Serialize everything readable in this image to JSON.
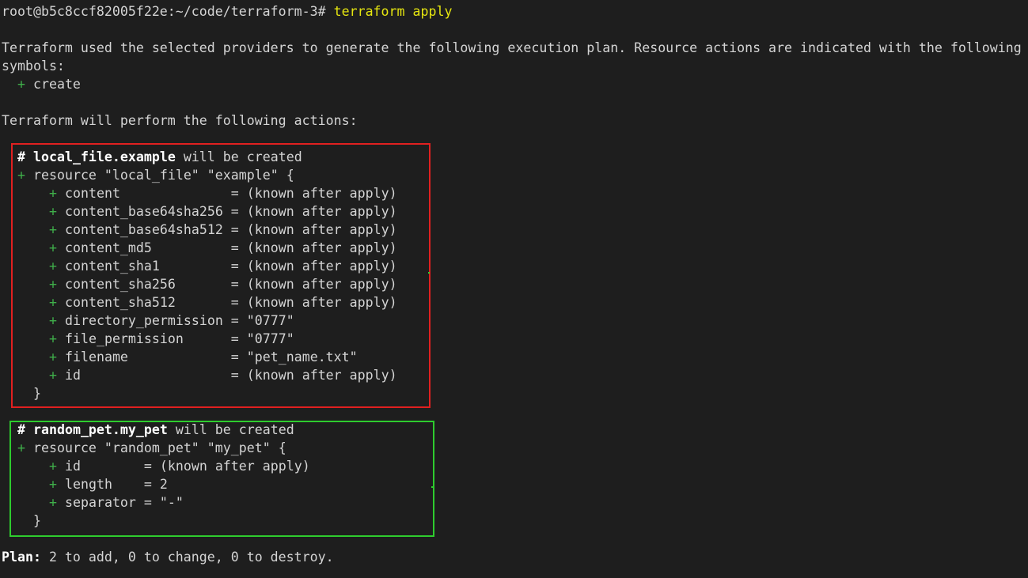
{
  "prompt": {
    "user_host_path": "root@b5c8ccf82005f22e:~/code/terraform-3#",
    "command": "terraform apply"
  },
  "intro": {
    "line1": "Terraform used the selected providers to generate the following execution plan. Resource actions are indicated with the following",
    "line2": "symbols:",
    "create_symbol": "+",
    "create_label": "create"
  },
  "actions_header": "Terraform will perform the following actions:",
  "resource1": {
    "comment_hash": "#",
    "comment_name": "local_file.example",
    "comment_suffix": "will be created",
    "plus": "+",
    "decl": "resource \"local_file\" \"example\" {",
    "attrs": [
      {
        "name": "content              ",
        "value": "= (known after apply)"
      },
      {
        "name": "content_base64sha256 ",
        "value": "= (known after apply)"
      },
      {
        "name": "content_base64sha512 ",
        "value": "= (known after apply)"
      },
      {
        "name": "content_md5          ",
        "value": "= (known after apply)"
      },
      {
        "name": "content_sha1         ",
        "value": "= (known after apply)"
      },
      {
        "name": "content_sha256       ",
        "value": "= (known after apply)"
      },
      {
        "name": "content_sha512       ",
        "value": "= (known after apply)"
      },
      {
        "name": "directory_permission ",
        "value": "= \"0777\""
      },
      {
        "name": "file_permission      ",
        "value": "= \"0777\""
      },
      {
        "name": "filename             ",
        "value": "= \"pet_name.txt\""
      },
      {
        "name": "id                   ",
        "value": "= (known after apply)"
      }
    ],
    "close": "}"
  },
  "resource2": {
    "comment_hash": "#",
    "comment_name": "random_pet.my_pet",
    "comment_suffix": "will be created",
    "plus": "+",
    "decl": "resource \"random_pet\" \"my_pet\" {",
    "attrs": [
      {
        "name": "id        ",
        "value": "= (known after apply)"
      },
      {
        "name": "length    ",
        "value": "= 2"
      },
      {
        "name": "separator ",
        "value": "= \"-\""
      }
    ],
    "close": "}"
  },
  "plan": {
    "label": "Plan:",
    "text": "2 to add, 0 to change, 0 to destroy."
  },
  "colors": {
    "background": "#1e1e1e",
    "text": "#d4d4d4",
    "plus_green": "#3fae4a",
    "command_yellow": "#e5e510",
    "box_red": "#e02020",
    "box_green": "#2ecc2e"
  }
}
